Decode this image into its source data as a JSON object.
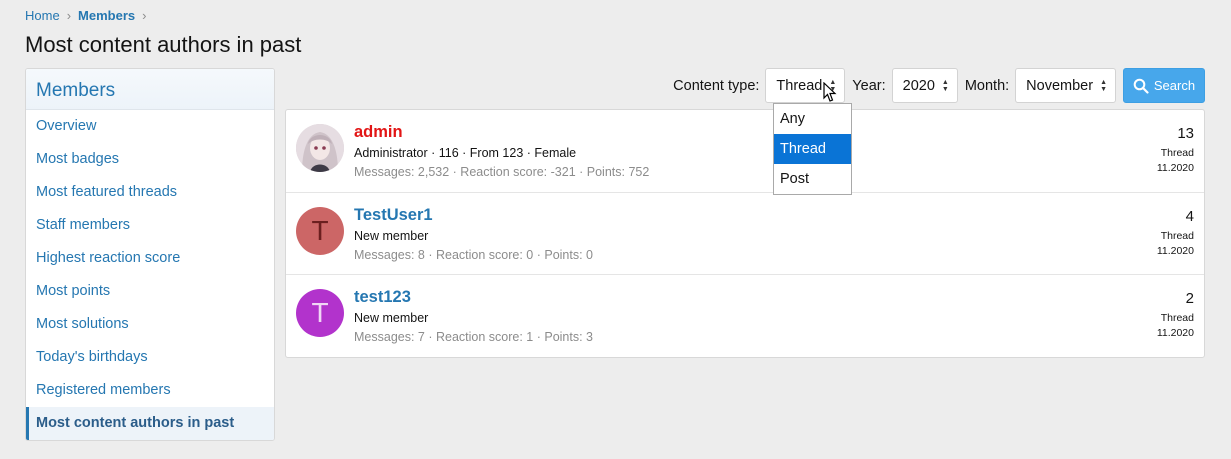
{
  "breadcrumb": {
    "home": "Home",
    "members": "Members",
    "sep": "›"
  },
  "page_title": "Most content authors in past",
  "sidebar": {
    "header": "Members",
    "items": [
      {
        "label": "Overview"
      },
      {
        "label": "Most badges"
      },
      {
        "label": "Most featured threads"
      },
      {
        "label": "Staff members"
      },
      {
        "label": "Highest reaction score"
      },
      {
        "label": "Most points"
      },
      {
        "label": "Most solutions"
      },
      {
        "label": "Today's birthdays"
      },
      {
        "label": "Registered members"
      },
      {
        "label": "Most content authors in past",
        "active": true
      }
    ]
  },
  "filters": {
    "content_type_label": "Content type:",
    "content_type_value": "Thread",
    "year_label": "Year:",
    "year_value": "2020",
    "month_label": "Month:",
    "month_value": "November",
    "search_label": "Search"
  },
  "dropdown": {
    "options": [
      "Any",
      "Thread",
      "Post"
    ],
    "selected": "Thread"
  },
  "members": [
    {
      "name": "admin",
      "title": "Administrator · 116 · From 123 · Female",
      "stats": "Messages: 2,532 · Reaction score: -321 · Points: 752",
      "count": "13",
      "type": "Thread",
      "date": "11.2020",
      "avatar_letter": "",
      "avatar_color": "#d8cfd4"
    },
    {
      "name": "TestUser1",
      "title": "New member",
      "stats": "Messages: 8 · Reaction score: 0 · Points: 0",
      "count": "4",
      "type": "Thread",
      "date": "11.2020",
      "avatar_letter": "T",
      "avatar_color": "#cc6666"
    },
    {
      "name": "test123",
      "title": "New member",
      "stats": "Messages: 7 · Reaction score: 1 · Points: 3",
      "count": "2",
      "type": "Thread",
      "date": "11.2020",
      "avatar_letter": "T",
      "avatar_color": "#b233cc"
    }
  ],
  "colors": {
    "link": "#2577b1",
    "admin_name": "#e21515",
    "search_button": "#47a7eb",
    "dropdown_selected": "#0a74d6"
  }
}
